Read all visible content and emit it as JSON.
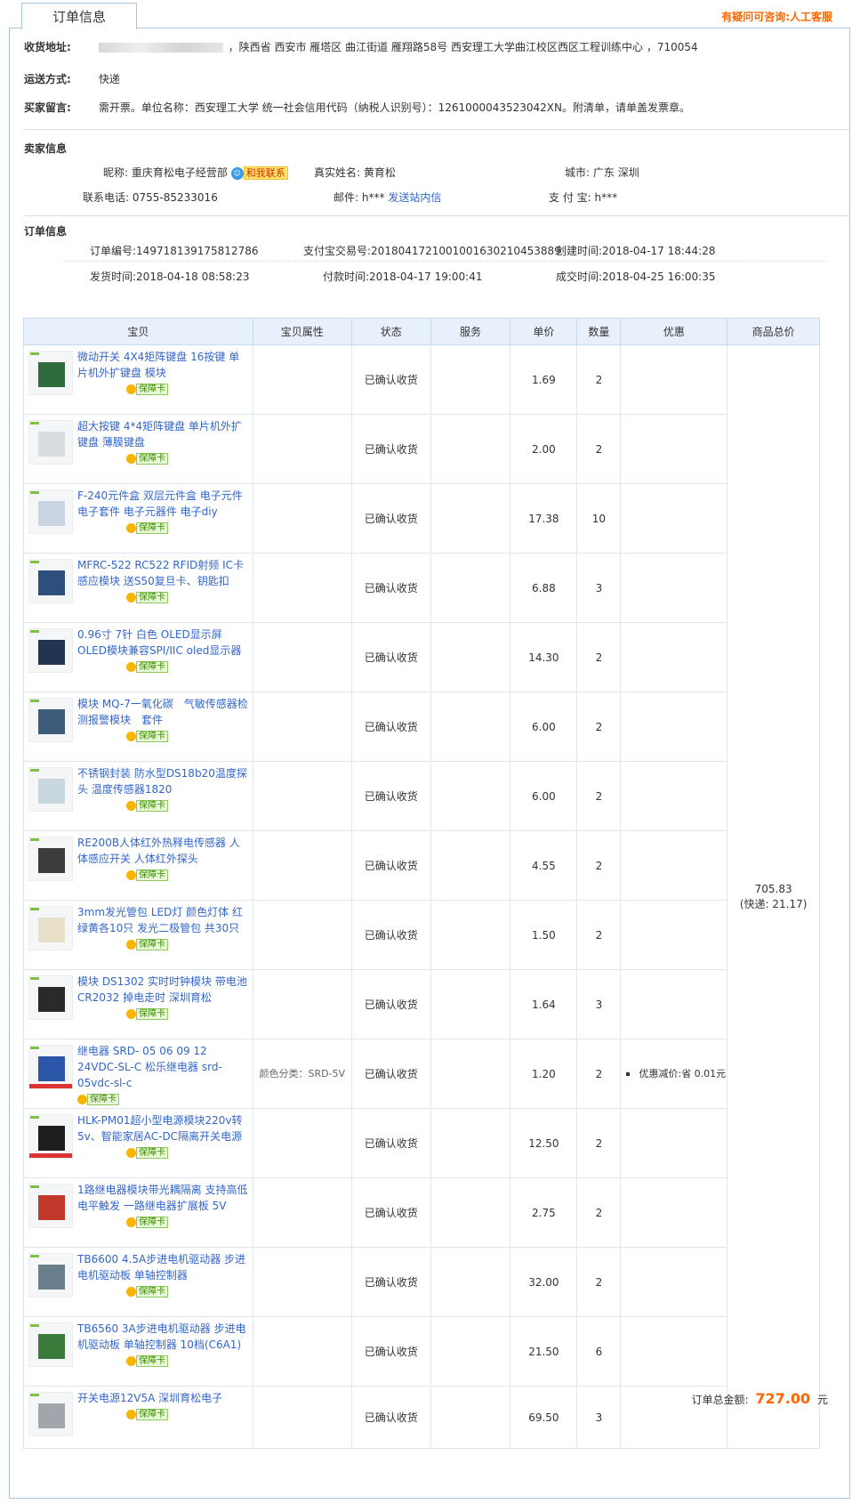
{
  "tab_title": "订单信息",
  "help_link": "有疑问可咨询:人工客服",
  "address": {
    "label": "收货地址:",
    "value": "，陕西省 西安市 雁塔区 曲江街道 雁翔路58号 西安理工大学曲江校区西区工程训练中心 ，710054"
  },
  "shipping": {
    "label": "运送方式:",
    "value": "快递"
  },
  "buyer_note": {
    "label": "买家留言:",
    "value": "需开票。单位名称：西安理工大学 统一社会信用代码（纳税人识别号）：1261000043523042XN。附清单，请单盖发票章。"
  },
  "seller": {
    "section_title": "卖家信息",
    "nick_label": "昵称:",
    "nick_value": "重庆育松电子经营部",
    "chat_label": "和我联系",
    "realname_label": "真实姓名:",
    "realname_value": "黄育松",
    "city_label": "城市:",
    "city_value": "广东 深圳",
    "phone_label": "联系电话:",
    "phone_value": "0755-85233016",
    "mail_label": "邮件:",
    "mail_value": "h***",
    "mail_link": "发送站内信",
    "alipay_label": "支 付 宝:",
    "alipay_value": "h***"
  },
  "order": {
    "section_title": "订单信息",
    "order_no": "订单编号:149718139175812786",
    "alipay_no": "支付宝交易号:20180417210010016302104538​89",
    "created": "创建时间:2018-04-17 18:44:28",
    "shipped": "发货时间:2018-04-18 08:58:23",
    "paid": "付款时间:2018-04-17 19:00:41",
    "closed": "成交时间:2018-04-25 16:00:35"
  },
  "table": {
    "headers": [
      "宝贝",
      "宝贝属性",
      "状态",
      "服务",
      "单价",
      "数量",
      "优惠",
      "商品总价"
    ],
    "guard_label": "保障卡",
    "status_text": "已确认收货",
    "total_price": "705.83",
    "total_shipping": "(快递: 21.17)",
    "items": [
      {
        "title": "微动开关 4X4矩阵键盘 16按键 单片机外扩键盘 模块",
        "attr": "",
        "price": "1.69",
        "qty": "2",
        "discount": ""
      },
      {
        "title": "超大按键 4*4矩阵键盘 单片机外扩键盘 薄膜键盘",
        "attr": "",
        "price": "2.00",
        "qty": "2",
        "discount": ""
      },
      {
        "title": "F-240元件盒 双层元件盒 电子元件电子套件 电子元器件 电子diy",
        "attr": "",
        "price": "17.38",
        "qty": "10",
        "discount": ""
      },
      {
        "title": "MFRC-522 RC522 RFID射频 IC卡感应模块 送S50复旦卡、钥匙扣",
        "attr": "",
        "price": "6.88",
        "qty": "3",
        "discount": ""
      },
      {
        "title": "0.96寸 7针 白色 OLED显示屏 OLED模块兼容SPI/IIC oled显示器",
        "attr": "",
        "price": "14.30",
        "qty": "2",
        "discount": ""
      },
      {
        "title": "模块 MQ-7一氧化碳　气敏传感器检测报警模块　套件",
        "attr": "",
        "price": "6.00",
        "qty": "2",
        "discount": ""
      },
      {
        "title": "不锈钢封装 防水型DS18b20温度探头 温度传感器1820",
        "attr": "",
        "price": "6.00",
        "qty": "2",
        "discount": ""
      },
      {
        "title": "RE200B人体红外热释电传感器 人体感应开关 人体红外探头",
        "attr": "",
        "price": "4.55",
        "qty": "2",
        "discount": ""
      },
      {
        "title": "3mm发光管包 LED灯 颜色灯体 红绿黄各10只 发光二极管包 共30只",
        "attr": "",
        "price": "1.50",
        "qty": "2",
        "discount": ""
      },
      {
        "title": "模块 DS1302 实时时钟模块 带电池CR2032 掉电走时 深圳育松",
        "attr": "",
        "price": "1.64",
        "qty": "3",
        "discount": ""
      },
      {
        "title": "继电器 SRD- 05 06 09 12 24VDC-SL-C 松乐继电器 srd-05vdc-sl-c",
        "attr": "颜色分类：SRD-5V",
        "price": "1.20",
        "qty": "2",
        "discount": "优惠减价:省 0.01元"
      },
      {
        "title": "HLK-PM01超小型电源模块220v转5v、智能家居AC-DC隔离开关电源",
        "attr": "",
        "price": "12.50",
        "qty": "2",
        "discount": ""
      },
      {
        "title": "1路继电器模块带光耦隔离 支持高低电平触发 一路继电器扩展板 5V",
        "attr": "",
        "price": "2.75",
        "qty": "2",
        "discount": ""
      },
      {
        "title": "TB6600 4.5A步进电机驱动器 步进电机驱动板 单轴控制器",
        "attr": "",
        "price": "32.00",
        "qty": "2",
        "discount": ""
      },
      {
        "title": "TB6560 3A步进电机驱动器 步进电机驱动板 单轴控制器 10档(C6A1)",
        "attr": "",
        "price": "21.50",
        "qty": "6",
        "discount": ""
      },
      {
        "title": "开关电源12V5A 深圳育松电子",
        "attr": "",
        "price": "69.50",
        "qty": "3",
        "discount": ""
      }
    ]
  },
  "grand_total": {
    "label": "订单总金额:",
    "amount": "727.00",
    "unit": "元"
  },
  "colors": {
    "link": "#3366cc",
    "accent": "#ff6600",
    "header_bg": "#e8f1fb",
    "border": "#a9c7e2"
  }
}
